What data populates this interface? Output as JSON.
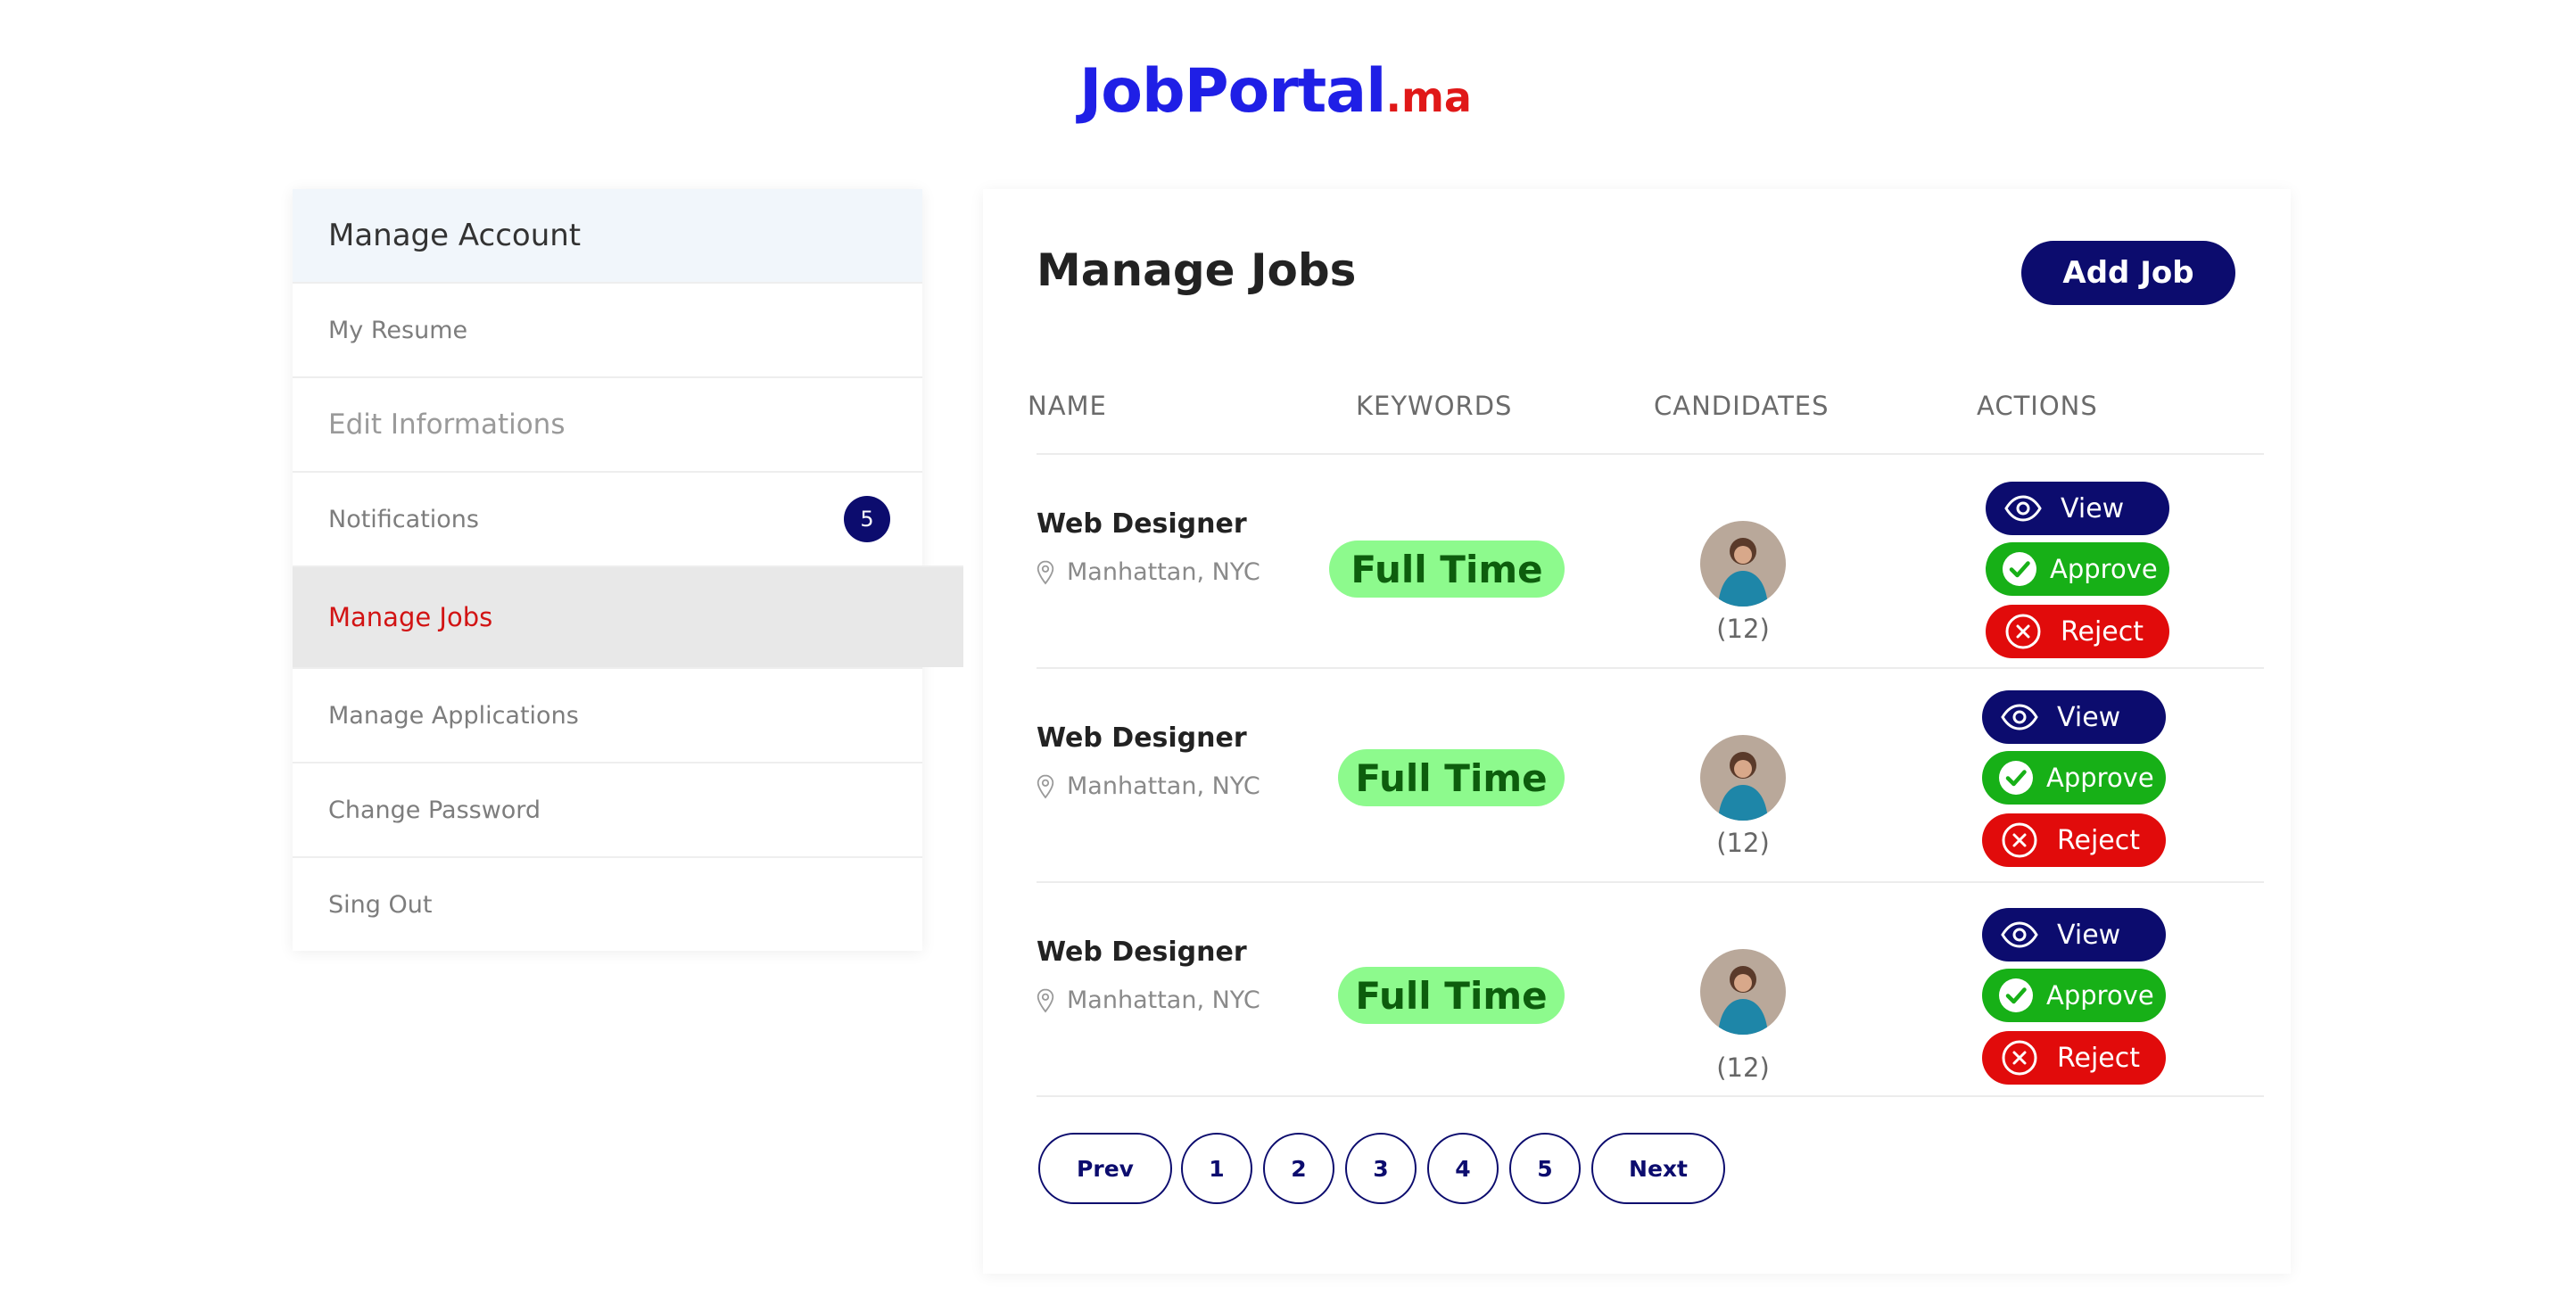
{
  "logo": {
    "name": "JobPortal",
    "tld": ".ma"
  },
  "sidebar": {
    "title": "Manage Account",
    "items": [
      {
        "label": "My Resume"
      },
      {
        "label": "Edit Informations"
      },
      {
        "label": "Notifications",
        "badge": "5"
      },
      {
        "label": "Manage Jobs",
        "active": true
      },
      {
        "label": "Manage Applications"
      },
      {
        "label": "Change Password"
      },
      {
        "label": "Sing Out"
      }
    ]
  },
  "main": {
    "title": "Manage Jobs",
    "add_button": "Add Job",
    "columns": [
      "NAME",
      "KEYWORDS",
      "CANDIDATES",
      "ACTIONS"
    ],
    "jobs": [
      {
        "title": "Web Designer",
        "location": "Manhattan, NYC",
        "keyword": "Full Time",
        "candidates": "(12)"
      },
      {
        "title": "Web Designer",
        "location": "Manhattan, NYC",
        "keyword": "Full Time",
        "candidates": "(12)"
      },
      {
        "title": "Web Designer",
        "location": "Manhattan, NYC",
        "keyword": "Full Time",
        "candidates": "(12)"
      }
    ],
    "actions": {
      "view": "View",
      "approve": "Approve",
      "reject": "Reject"
    }
  },
  "pagination": {
    "prev": "Prev",
    "pages": [
      "1",
      "2",
      "3",
      "4",
      "5"
    ],
    "next": "Next"
  },
  "colors": {
    "brand": "#1f1fe6",
    "tld": "#e01818",
    "navy": "#0c0c6e",
    "approve": "#17b017",
    "reject": "#e10b0b",
    "keyword_bg": "#8dfa8d",
    "active_item": "#d21414"
  }
}
